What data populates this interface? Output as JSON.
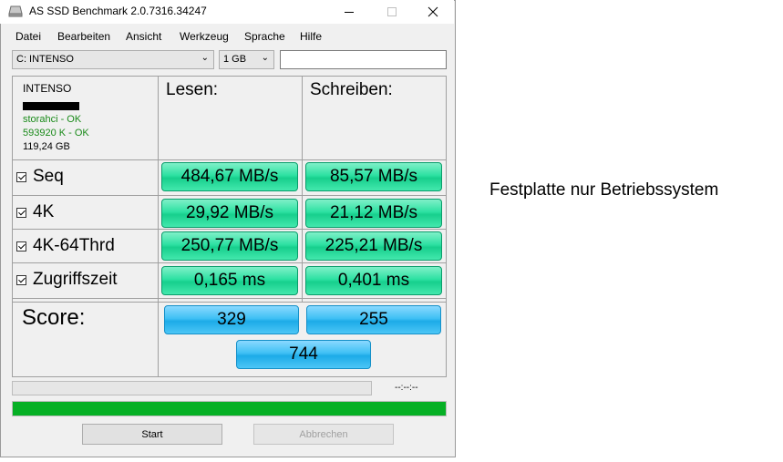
{
  "window": {
    "title": "AS SSD Benchmark 2.0.7316.34247",
    "minimize_icon": "minimize-icon",
    "maximize_icon": "maximize-icon",
    "close_icon": "close-icon"
  },
  "menu": [
    "Datei",
    "Bearbeiten",
    "Ansicht",
    "Werkzeug",
    "Sprache",
    "Hilfe"
  ],
  "toolbar": {
    "drive_select": "C: INTENSO",
    "size_select": "1 GB",
    "text_input": ""
  },
  "drive": {
    "name": "INTENSO",
    "driver_status": "storahci - OK",
    "alignment_status": "593920 K - OK",
    "capacity": "119,24 GB"
  },
  "headers": {
    "read": "Lesen:",
    "write": "Schreiben:"
  },
  "tests": [
    {
      "label": "Seq",
      "checked": true,
      "read": "484,67 MB/s",
      "write": "85,57 MB/s"
    },
    {
      "label": "4K",
      "checked": true,
      "read": "29,92 MB/s",
      "write": "21,12 MB/s"
    },
    {
      "label": "4K-64Thrd",
      "checked": true,
      "read": "250,77 MB/s",
      "write": "225,21 MB/s"
    },
    {
      "label": "Zugriffszeit",
      "checked": true,
      "read": "0,165 ms",
      "write": "0,401 ms"
    }
  ],
  "score": {
    "label": "Score:",
    "read": "329",
    "write": "255",
    "total": "744"
  },
  "progress": {
    "top_fraction": 0.0,
    "time_text": "--:--:--",
    "bottom_fraction": 1.0,
    "bottom_color": "#06b025"
  },
  "buttons": {
    "start": "Start",
    "abort": "Abbrechen"
  },
  "caption": "Festplatte nur Betriebssystem"
}
